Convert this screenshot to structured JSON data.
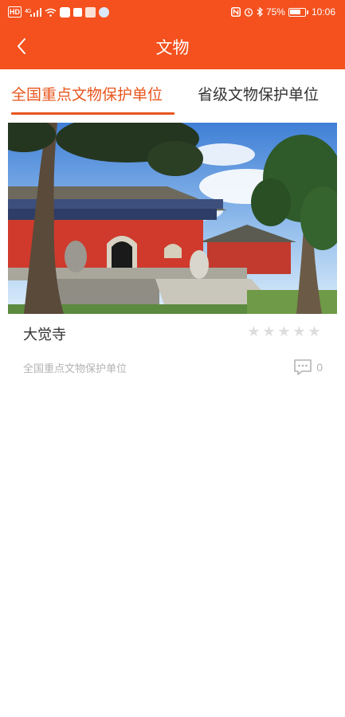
{
  "status_bar": {
    "network_badge": "HD",
    "network_type": "4G",
    "battery_percent": "75%",
    "battery_level": 0.75,
    "time": "10:06"
  },
  "header": {
    "title": "文物",
    "background_color": "#f4511e",
    "back_icon": "chevron-left-icon"
  },
  "tabs": [
    {
      "label": "全国重点文物保护单位",
      "active": true
    },
    {
      "label": "省级文物保护单位",
      "active": false
    }
  ],
  "accent_color": "#e8561e",
  "list": [
    {
      "name": "大觉寺",
      "level": "全国重点文物保护单位",
      "rating": 0,
      "rating_max": 5,
      "comment_count": "0",
      "comment_icon": "comment-bubble-icon"
    }
  ]
}
